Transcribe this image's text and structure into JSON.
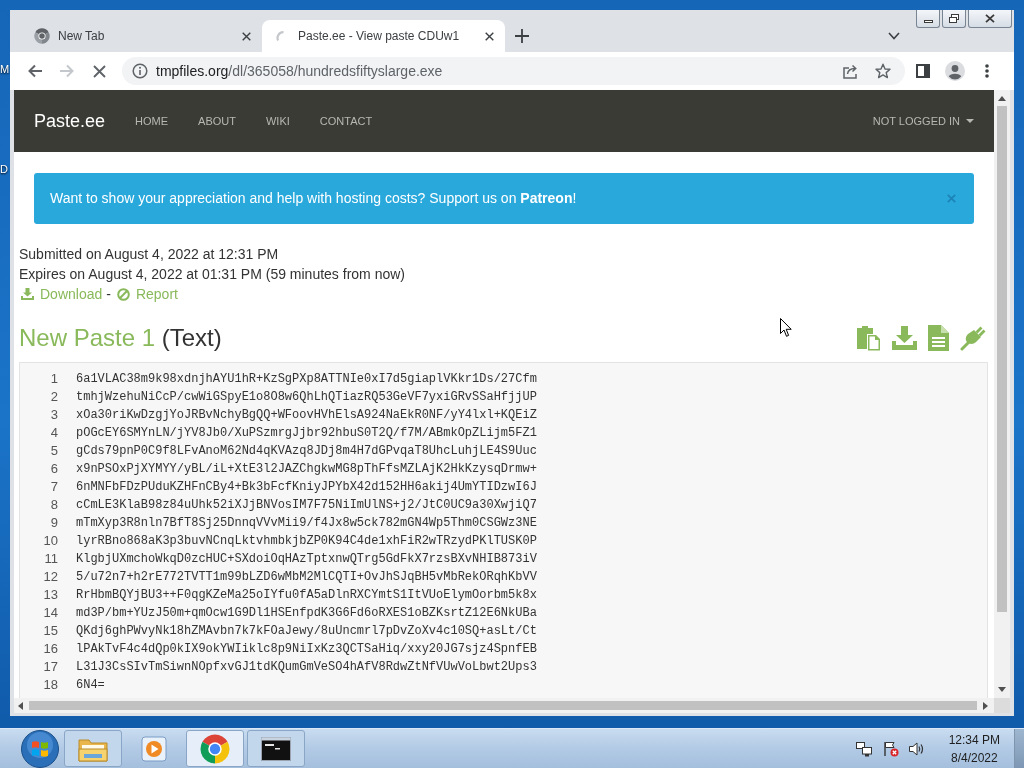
{
  "desktop": {
    "icon_labels": [
      "M",
      "D"
    ]
  },
  "browser": {
    "tabs": [
      {
        "title": "New Tab",
        "selected": false,
        "loading": false
      },
      {
        "title": "Paste.ee - View paste CDUw1",
        "selected": true,
        "loading": true
      }
    ],
    "navigation": {
      "back_enabled": true,
      "forward_enabled": false,
      "loading": true
    },
    "address_bar": {
      "host": "tmpfiles.org",
      "path": "/dl/365058/hundredsfiftyslarge.exe"
    }
  },
  "page": {
    "navbar": {
      "brand": "Paste.ee",
      "links": [
        "HOME",
        "ABOUT",
        "WIKI",
        "CONTACT"
      ],
      "account": "NOT LOGGED IN"
    },
    "banner": {
      "text": "Want to show your appreciation and help with hosting costs? Support us on **Patreon**!"
    },
    "meta": [
      "Submitted on August 4, 2022 at 12:31 PM",
      "Expires on August 4, 2022 at 01:31 PM (59 minutes from now)"
    ],
    "actions": [
      {
        "kind": "download",
        "label": "Download"
      },
      {
        "kind": "report",
        "label": "Report"
      }
    ],
    "action_separator": "-",
    "paste": {
      "title": "New Paste 1",
      "format": "(Text)",
      "lines": [
        {
          "number": "1",
          "text": "6a1VLAC38m9k98xdnjhAYU1hR+KzSgPXp8ATTNIe0xI7d5giaplVKkr1Ds/27Cfm"
        },
        {
          "number": "2",
          "text": "tmhjWzehuNiCcP/cwWiGSpyE1o8O8w6QhLhQTiazRQ53GeVF7yxiGRvSSaHfjjUP"
        },
        {
          "number": "3",
          "text": "xOa30riKwDzgjYoJRBvNchyBgQQ+WFoovHVhElsA924NaEkR0NF/yY4lxl+KQEiZ"
        },
        {
          "number": "4",
          "text": "pOGcEY6SMYnLN/jYV8Jb0/XuPSzmrgJjbr92hbuS0T2Q/f7M/ABmkOpZLijm5FZ1"
        },
        {
          "number": "5",
          "text": "gCds79pnP0C9f8LFvAnoM62Nd4qKVAzq8JDj8m4H7dGPvqaT8UhcLuhjLE4S9Uuc"
        },
        {
          "number": "6",
          "text": "x9nPSOxPjXYMYY/yBL/iL+XtE3l2JAZChgkwMG8pThFfsMZLAjK2HkKzysqDrmw+"
        },
        {
          "number": "7",
          "text": "6nMNFbFDzPUduKZHFnCBy4+Bk3bFcfKniyJPYbX42d152HH6akij4UmYTIDzwI6J"
        },
        {
          "number": "8",
          "text": "cCmLE3KlaB98z84uUhk52iXJjBNVosIM7F75NiImUlNS+j2/JtC0UC9a30XwjiQ7"
        },
        {
          "number": "9",
          "text": "mTmXyp3R8nln7BfT8Sj25DnnqVVvMii9/f4Jx8w5ck782mGN4Wp5Thm0CSGWz3NE"
        },
        {
          "number": "10",
          "text": "lyrRBno868aK3p3buvNCnqLktvhmbkjbZP0K94C4de1xhFiR2wTRzydPKlTUSK0P"
        },
        {
          "number": "11",
          "text": "KlgbjUXmchoWkqD0zcHUC+SXdoiOqHAzTptxnwQTrg5GdFkX7rzsBXvNHIB873iV"
        },
        {
          "number": "12",
          "text": "5/u72n7+h2rE772TVTT1m99bLZD6wMbM2MlCQTI+OvJhSJqBH5vMbRekORqhKbVV"
        },
        {
          "number": "13",
          "text": "RrHbmBQYjBU3++F0qgKZeMa25oIYfu0fA5aDlnRXCYmtS1ItVUoElymOorbm5k8x"
        },
        {
          "number": "14",
          "text": "md3P/bm+YUzJ50m+qmOcw1G9Dl1HSEnfpdK3G6Fd6oRXES1oBZKsrtZ12E6NkUBa"
        },
        {
          "number": "15",
          "text": "QKdj6ghPWvyNk18hZMAvbn7k7kFOaJewy/8uUncmrl7pDvZoXv4c10SQ+asLt/Ct"
        },
        {
          "number": "16",
          "text": "lPAkTvF4c4dQp0kIX9okYWIiklc8p9NiIxKz3QCTSaHiq/xxy20JG7sjz4SpnfEB"
        },
        {
          "number": "17",
          "text": "L31J3CsSIvTmSiwnNOpfxvGJ1tdKQumGmVeSO4hAfV8RdwZtNfVUwVoLbwt2Ups3"
        },
        {
          "number": "18",
          "text": "6N4="
        }
      ]
    }
  },
  "taskbar": {
    "apps": [
      {
        "kind": "folder",
        "running": true,
        "selected": false
      },
      {
        "kind": "media",
        "running": false,
        "selected": false
      },
      {
        "kind": "browser",
        "running": true,
        "selected": true
      },
      {
        "kind": "terminal",
        "running": true,
        "selected": false
      }
    ],
    "clock": {
      "time": "12:34 PM",
      "date": "8/4/2022"
    }
  }
}
